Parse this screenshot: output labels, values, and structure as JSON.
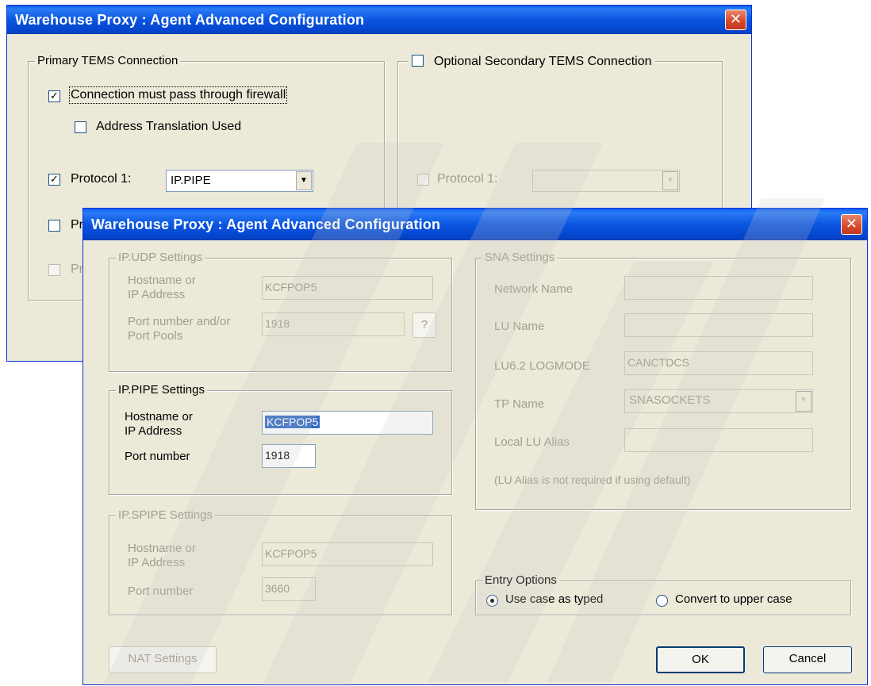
{
  "back_dialog": {
    "title": "Warehouse Proxy : Agent Advanced Configuration",
    "close_glyph": "✕",
    "primary": {
      "legend": "Primary TEMS Connection",
      "firewall_label": "Connection must pass through firewall",
      "firewall_checked": true,
      "address_translation_label": "Address Translation Used",
      "address_translation_checked": false,
      "protocol1_label": "Protocol 1:",
      "protocol1_checked": true,
      "protocol1_value": "IP.PIPE",
      "protocol2_partial": "Pr",
      "protocol3_partial": "Pr"
    },
    "secondary": {
      "legend": "Optional Secondary TEMS Connection",
      "protocol1_label": "Protocol 1:"
    }
  },
  "front_dialog": {
    "title": "Warehouse Proxy : Agent Advanced Configuration",
    "close_glyph": "✕",
    "ip_udp": {
      "legend": "IP.UDP Settings",
      "host_label_1": "Hostname or",
      "host_label_2": "IP Address",
      "host_value": "KCFPOP5",
      "port_label_1": "Port number and/or",
      "port_label_2": "Port Pools",
      "port_value": "1918",
      "help_label": "?"
    },
    "ip_pipe": {
      "legend": "IP.PIPE Settings",
      "host_label_1": "Hostname or",
      "host_label_2": "IP Address",
      "host_value": "KCFPOP5",
      "port_label": "Port number",
      "port_value": "1918"
    },
    "ip_spipe": {
      "legend": "IP.SPIPE Settings",
      "host_label_1": "Hostname or",
      "host_label_2": "IP Address",
      "host_value": "KCFPOP5",
      "port_label": "Port number",
      "port_value": "3660"
    },
    "sna": {
      "legend": "SNA Settings",
      "network_name_label": "Network Name",
      "network_name_value": "",
      "lu_name_label": "LU Name",
      "lu_name_value": "",
      "logmode_label": "LU6.2 LOGMODE",
      "logmode_value": "CANCTDCS",
      "tp_name_label": "TP Name",
      "tp_name_value": "SNASOCKETS",
      "local_lu_label": "Local LU Alias",
      "local_lu_value": "",
      "note": "(LU Alias is not required if using default)"
    },
    "entry_options": {
      "legend": "Entry Options",
      "option_typed": "Use case as typed",
      "option_upper": "Convert to upper case",
      "selected": "typed"
    },
    "nat_button": "NAT Settings",
    "ok_button": "OK",
    "cancel_button": "Cancel"
  },
  "colors": {
    "title_blue": "#0b55e0",
    "dialog_face": "#ece9d8",
    "close_red": "#d5472a",
    "selection": "#316ac5",
    "disabled_text": "#a19e91"
  }
}
